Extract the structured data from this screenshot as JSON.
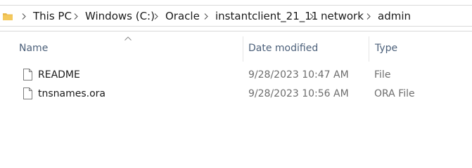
{
  "address_bar": {
    "breadcrumbs": [
      {
        "label": "This PC"
      },
      {
        "label": "Windows (C:)"
      },
      {
        "label": "Oracle"
      },
      {
        "label": "instantclient_21_11"
      },
      {
        "label": "network"
      },
      {
        "label": "admin"
      }
    ]
  },
  "columns": {
    "name": "Name",
    "date_modified": "Date modified",
    "type": "Type",
    "sorted_by": "name",
    "sort_direction": "ascending"
  },
  "files": [
    {
      "name": "README",
      "date_modified": "9/28/2023 10:47 AM",
      "type": "File",
      "icon": "file-icon"
    },
    {
      "name": "tnsnames.ora",
      "date_modified": "9/28/2023 10:56 AM",
      "type": "ORA File",
      "icon": "file-icon"
    }
  ],
  "colors": {
    "header_text": "#4c607a",
    "secondary_text": "#6d6d6d",
    "folder_yellow": "#e8b84a"
  }
}
